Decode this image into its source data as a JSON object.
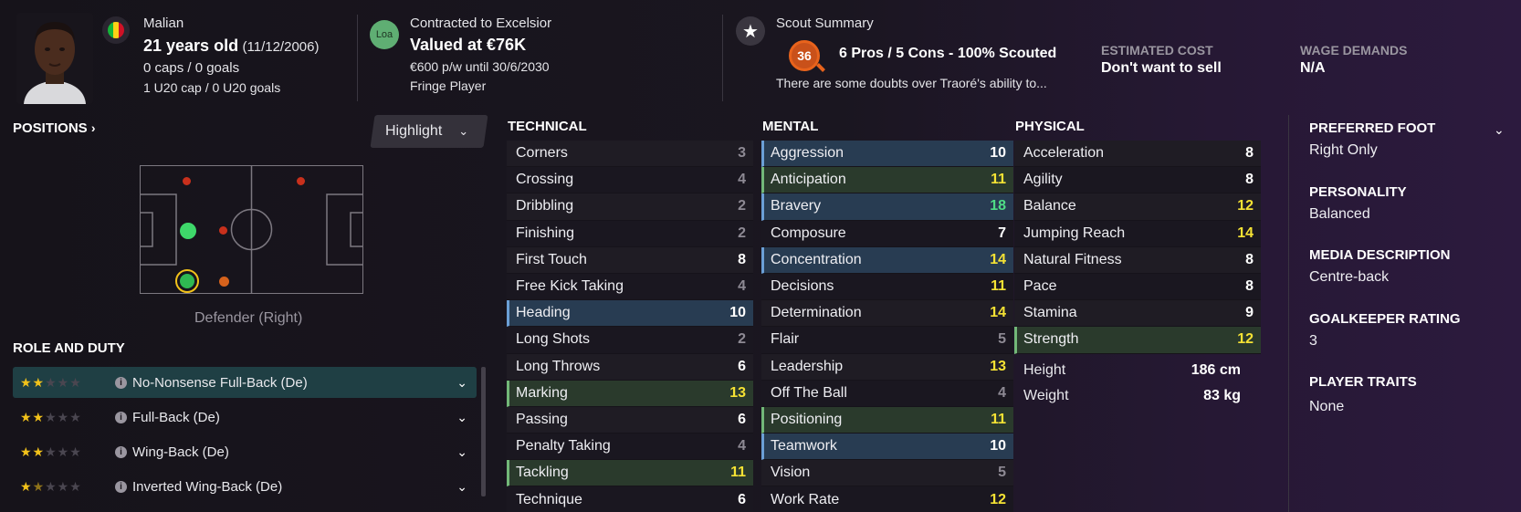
{
  "header": {
    "nationality": "Malian",
    "age": "21 years old",
    "dob": "(11/12/2006)",
    "caps": "0 caps / 0 goals",
    "u20_caps": "1 U20 cap / 0 U20 goals",
    "contract_label": "Contracted to Excelsior",
    "loan_badge": "Loa",
    "value": "Valued at €76K",
    "wage_line": "€600 p/w until 30/6/2030",
    "squad_status": "Fringe Player",
    "scout_title": "Scout Summary",
    "scout_score": "36",
    "scout_line": "6 Pros / 5 Cons - 100% Scouted",
    "scout_desc": "There are some doubts over Traoré's ability to...",
    "est_cost_label": "ESTIMATED COST",
    "est_cost_value": "Don't want to sell",
    "wage_demands_label": "WAGE DEMANDS",
    "wage_demands_value": "N/A"
  },
  "positions": {
    "title": "POSITIONS",
    "title_icon": "chevron-right-icon",
    "highlight_label": "Highlight",
    "position_label": "Defender (Right)"
  },
  "roles": {
    "title": "ROLE AND DUTY",
    "items": [
      {
        "label": "No-Nonsense Full-Back (De)",
        "stars": 2
      },
      {
        "label": "Full-Back (De)",
        "stars": 2
      },
      {
        "label": "Wing-Back (De)",
        "stars": 2
      },
      {
        "label": "Inverted Wing-Back (De)",
        "stars": 1.5
      }
    ]
  },
  "technical": {
    "title": "TECHNICAL",
    "rows": [
      {
        "name": "Corners",
        "value": "3"
      },
      {
        "name": "Crossing",
        "value": "4"
      },
      {
        "name": "Dribbling",
        "value": "2"
      },
      {
        "name": "Finishing",
        "value": "2"
      },
      {
        "name": "First Touch",
        "value": "8"
      },
      {
        "name": "Free Kick Taking",
        "value": "4"
      },
      {
        "name": "Heading",
        "value": "10"
      },
      {
        "name": "Long Shots",
        "value": "2"
      },
      {
        "name": "Long Throws",
        "value": "6"
      },
      {
        "name": "Marking",
        "value": "13"
      },
      {
        "name": "Passing",
        "value": "6"
      },
      {
        "name": "Penalty Taking",
        "value": "4"
      },
      {
        "name": "Tackling",
        "value": "11"
      },
      {
        "name": "Technique",
        "value": "6"
      }
    ]
  },
  "mental": {
    "title": "MENTAL",
    "rows": [
      {
        "name": "Aggression",
        "value": "10"
      },
      {
        "name": "Anticipation",
        "value": "11"
      },
      {
        "name": "Bravery",
        "value": "18"
      },
      {
        "name": "Composure",
        "value": "7"
      },
      {
        "name": "Concentration",
        "value": "14"
      },
      {
        "name": "Decisions",
        "value": "11"
      },
      {
        "name": "Determination",
        "value": "14"
      },
      {
        "name": "Flair",
        "value": "5"
      },
      {
        "name": "Leadership",
        "value": "13"
      },
      {
        "name": "Off The Ball",
        "value": "4"
      },
      {
        "name": "Positioning",
        "value": "11"
      },
      {
        "name": "Teamwork",
        "value": "10"
      },
      {
        "name": "Vision",
        "value": "5"
      },
      {
        "name": "Work Rate",
        "value": "12"
      }
    ]
  },
  "physical": {
    "title": "PHYSICAL",
    "rows": [
      {
        "name": "Acceleration",
        "value": "8"
      },
      {
        "name": "Agility",
        "value": "8"
      },
      {
        "name": "Balance",
        "value": "12"
      },
      {
        "name": "Jumping Reach",
        "value": "14"
      },
      {
        "name": "Natural Fitness",
        "value": "8"
      },
      {
        "name": "Pace",
        "value": "8"
      },
      {
        "name": "Stamina",
        "value": "9"
      },
      {
        "name": "Strength",
        "value": "12"
      }
    ],
    "height_label": "Height",
    "height_value": "186 cm",
    "weight_label": "Weight",
    "weight_value": "83 kg"
  },
  "info": {
    "preferred_foot_label": "PREFERRED FOOT",
    "preferred_foot_value": "Right Only",
    "personality_label": "PERSONALITY",
    "personality_value": "Balanced",
    "media_label": "MEDIA DESCRIPTION",
    "media_value": "Centre-back",
    "gk_label": "GOALKEEPER RATING",
    "gk_value": "3",
    "traits_label": "PLAYER TRAITS",
    "traits_value": "None"
  },
  "colors": {
    "highlight_blue": "#283c52",
    "highlight_green": "#2a3a2c",
    "value_yellow": "#f5e234",
    "value_green": "#4fdc86",
    "value_gray": "#8e8a94",
    "star": "#f2c21a"
  }
}
